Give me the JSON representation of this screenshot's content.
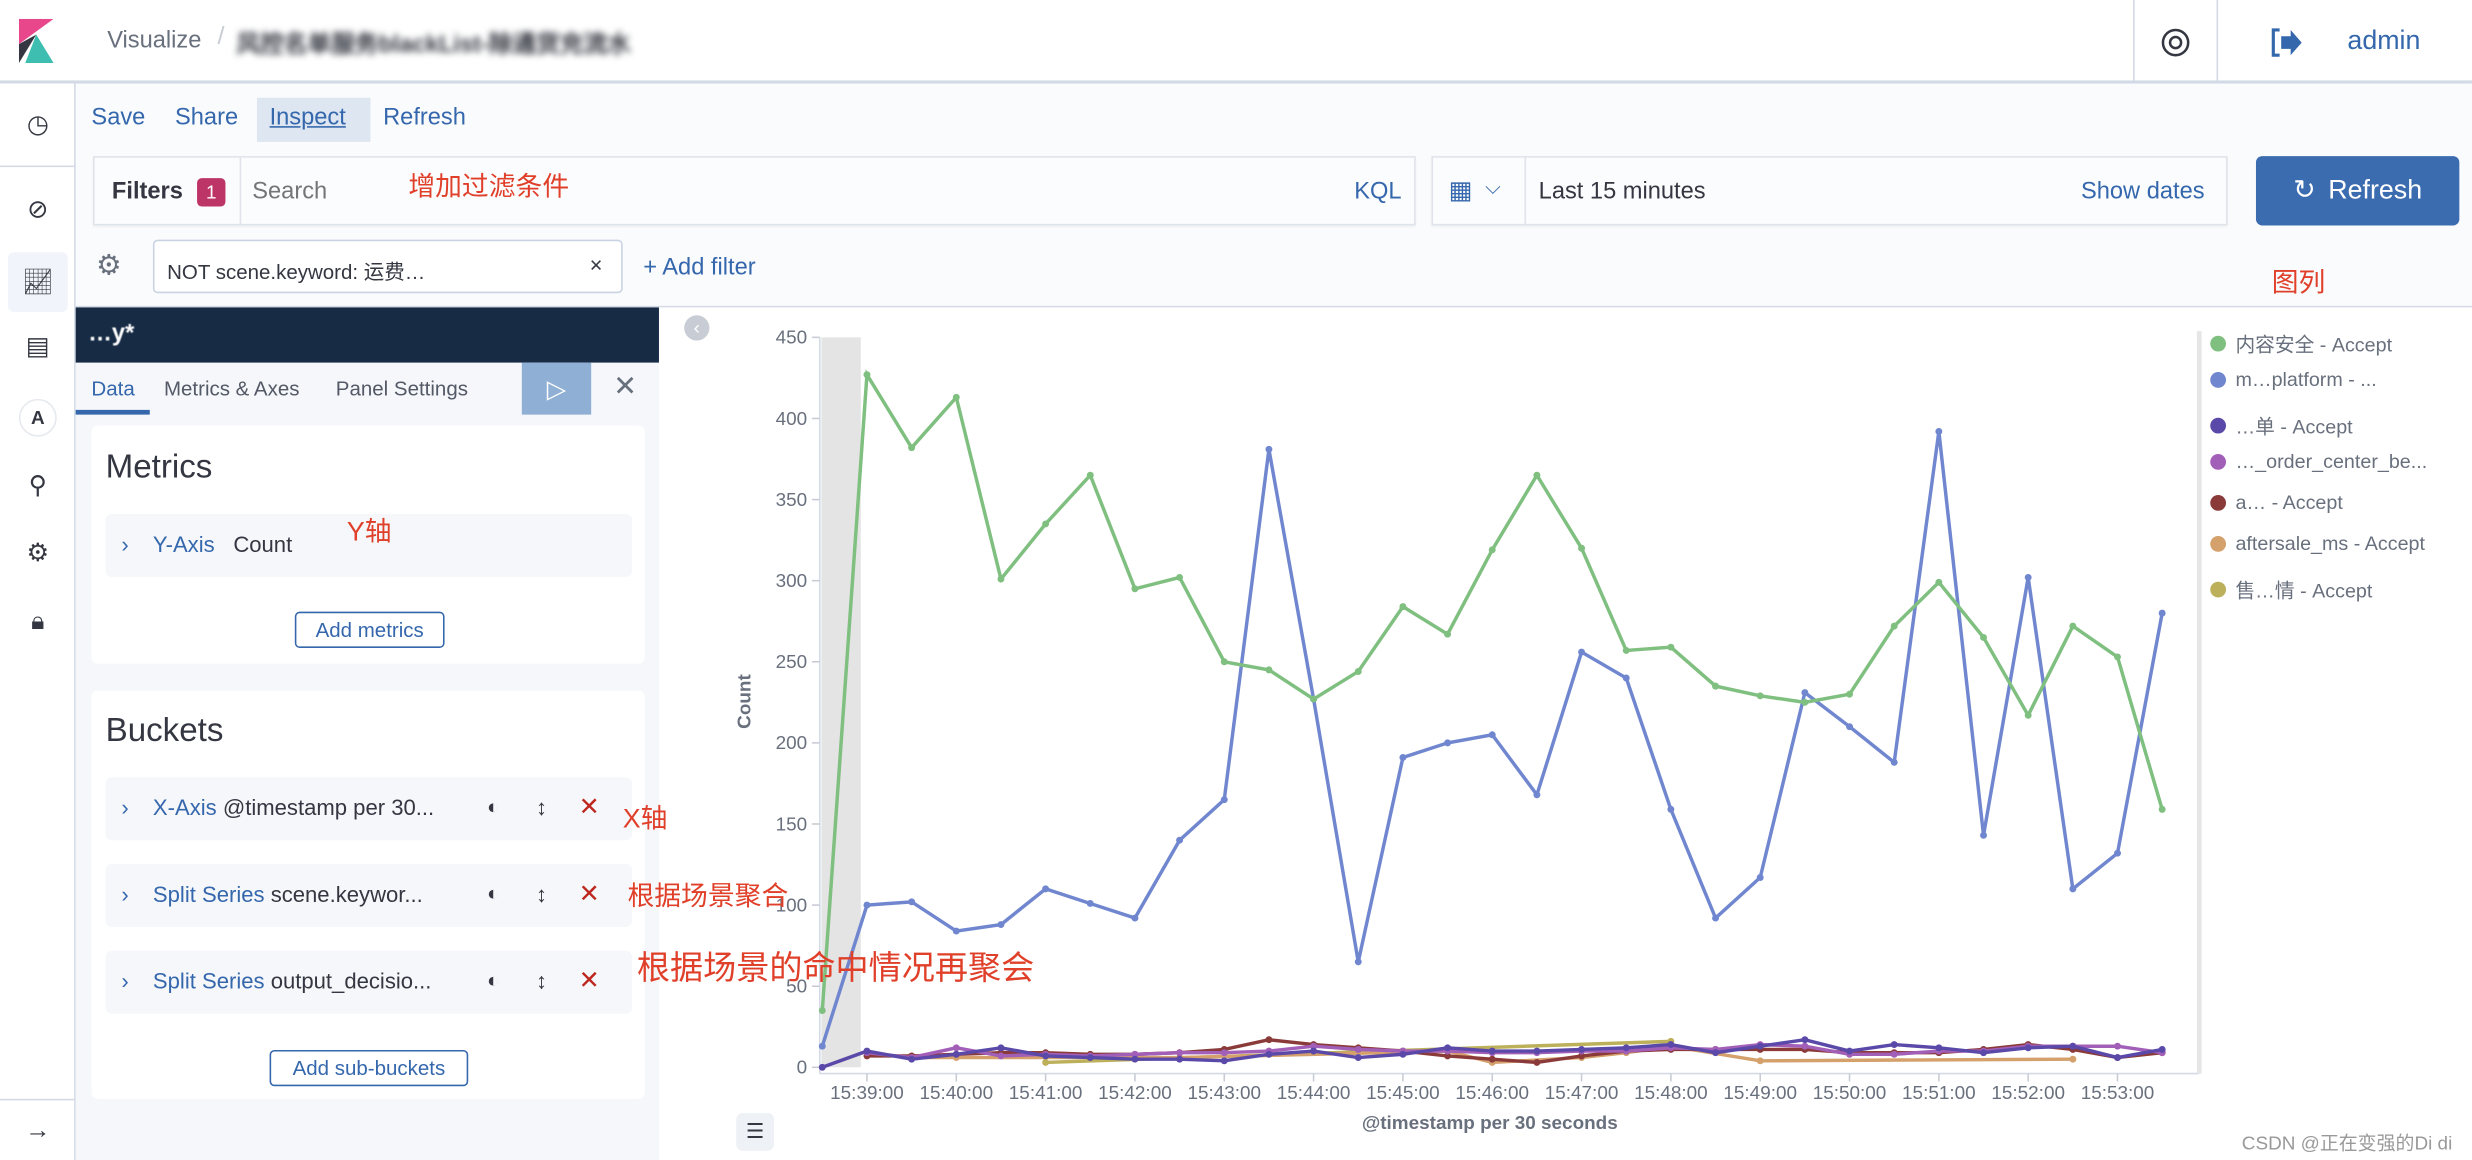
{
  "header": {
    "breadcrumb_root": "Visualize",
    "breadcrumb_title": "风控名单服务blackList-除通货充流水",
    "user": "admin",
    "icons": [
      "kibana-logo",
      "help-icon",
      "logout-icon"
    ]
  },
  "nav": {
    "icons": [
      "clock-icon",
      "discover-icon",
      "visualize-icon",
      "dashboard-icon",
      "avatar-a",
      "dev-tools-icon",
      "gear-icon",
      "lock-icon",
      "expand-arrow-icon"
    ],
    "avatar_letter": "A"
  },
  "top_menu": {
    "save": "Save",
    "share": "Share",
    "inspect": "Inspect",
    "refresh": "Refresh"
  },
  "query_bar": {
    "filters_label": "Filters",
    "filters_count": "1",
    "search_placeholder": "Search",
    "language": "KQL",
    "time_range": "Last 15 minutes",
    "show_dates": "Show dates",
    "refresh_button": "Refresh"
  },
  "filter_pill": {
    "label": "NOT scene.keyword: 运费…",
    "add_filter": "+ Add filter"
  },
  "annotations": {
    "filter": "增加过滤条件",
    "legend": "图列",
    "y_axis": "Y轴",
    "x_axis": "X轴",
    "split1": "根据场景聚合",
    "split2": "根据场景的命中情况再聚会"
  },
  "editor": {
    "index_title": "…y*",
    "tabs": [
      "Data",
      "Metrics & Axes",
      "Panel Settings"
    ],
    "metrics_title": "Metrics",
    "metric_row": {
      "type": "Y-Axis",
      "value": "Count"
    },
    "add_metrics": "Add metrics",
    "buckets_title": "Buckets",
    "buckets": [
      {
        "type": "X-Axis",
        "value": "@timestamp per 30..."
      },
      {
        "type": "Split Series",
        "value": "scene.keywor..."
      },
      {
        "type": "Split Series",
        "value": "output_decisio..."
      }
    ],
    "add_sub_buckets": "Add sub-buckets"
  },
  "watermark": "CSDN @正在变强的Di di",
  "chart_data": {
    "type": "line",
    "xlabel": "@timestamp per 30 seconds",
    "ylabel": "Count",
    "ylim": [
      0,
      450
    ],
    "yticks": [
      0,
      50,
      100,
      150,
      200,
      250,
      300,
      350,
      400,
      450
    ],
    "x": [
      "15:38:30",
      "15:39:00",
      "15:39:30",
      "15:40:00",
      "15:40:30",
      "15:41:00",
      "15:41:30",
      "15:42:00",
      "15:42:30",
      "15:43:00",
      "15:43:30",
      "15:44:00",
      "15:44:30",
      "15:45:00",
      "15:45:30",
      "15:46:00",
      "15:46:30",
      "15:47:00",
      "15:47:30",
      "15:48:00",
      "15:48:30",
      "15:49:00",
      "15:49:30",
      "15:50:00",
      "15:50:30",
      "15:51:00",
      "15:51:30",
      "15:52:00",
      "15:52:30",
      "15:53:00",
      "15:53:30"
    ],
    "xtick_labels": [
      "15:39:00",
      "15:40:00",
      "15:41:00",
      "15:42:00",
      "15:43:00",
      "15:44:00",
      "15:45:00",
      "15:46:00",
      "15:47:00",
      "15:48:00",
      "15:49:00",
      "15:50:00",
      "15:51:00",
      "15:52:00",
      "15:53:00"
    ],
    "legend_position": "right",
    "grid": false,
    "series": [
      {
        "name": "内容安全 - Accept",
        "color": "#7fbf7f",
        "values": [
          35,
          427,
          382,
          413,
          301,
          335,
          365,
          295,
          302,
          250,
          245,
          227,
          244,
          284,
          267,
          319,
          365,
          320,
          257,
          259,
          235,
          229,
          225,
          230,
          272,
          299,
          265,
          217,
          272,
          253,
          159
        ]
      },
      {
        "name": "m…platform - ...",
        "color": "#7087d0",
        "values": [
          13,
          100,
          102,
          84,
          88,
          110,
          101,
          92,
          140,
          165,
          381,
          227,
          65,
          191,
          200,
          205,
          168,
          256,
          240,
          159,
          92,
          117,
          231,
          210,
          188,
          392,
          143,
          302,
          110,
          132,
          280
        ]
      },
      {
        "name": "…单 - Accept",
        "color": "#5a49a8",
        "values": [
          0,
          10,
          5,
          8,
          12,
          7,
          6,
          5,
          5,
          4,
          8,
          10,
          6,
          8,
          12,
          10,
          10,
          11,
          12,
          14,
          9,
          13,
          17,
          10,
          14,
          12,
          9,
          12,
          13,
          6,
          11
        ]
      },
      {
        "name": "…_order_center_be...",
        "color": "#a25fb8",
        "values": [
          null,
          9,
          6,
          12,
          7,
          8,
          7,
          8,
          9,
          9,
          10,
          13,
          11,
          10,
          10,
          9,
          9,
          10,
          10,
          12,
          11,
          14,
          13,
          8,
          8,
          10,
          10,
          13,
          13,
          13,
          9
        ]
      },
      {
        "name": "a… - Accept",
        "color": "#8b3a3a",
        "values": [
          null,
          7,
          7,
          8,
          9,
          9,
          8,
          8,
          9,
          11,
          17,
          14,
          12,
          10,
          7,
          5,
          3,
          7,
          10,
          11,
          11,
          11,
          11,
          9,
          9,
          9,
          11,
          14,
          11,
          6,
          9
        ]
      },
      {
        "name": "aftersale_ms - Accept",
        "color": "#d4a06b",
        "values": [
          null,
          null,
          6,
          6,
          null,
          null,
          null,
          null,
          6,
          null,
          null,
          null,
          null,
          null,
          10,
          3,
          null,
          6,
          9,
          13,
          null,
          4,
          null,
          null,
          null,
          null,
          null,
          null,
          5,
          null,
          null
        ]
      },
      {
        "name": "售…情 - Accept",
        "color": "#bcb05b",
        "values": [
          null,
          null,
          null,
          null,
          null,
          3,
          null,
          null,
          null,
          null,
          null,
          null,
          null,
          null,
          null,
          null,
          null,
          null,
          null,
          16,
          null,
          null,
          null,
          null,
          null,
          null,
          null,
          null,
          null,
          null,
          null
        ]
      }
    ]
  }
}
